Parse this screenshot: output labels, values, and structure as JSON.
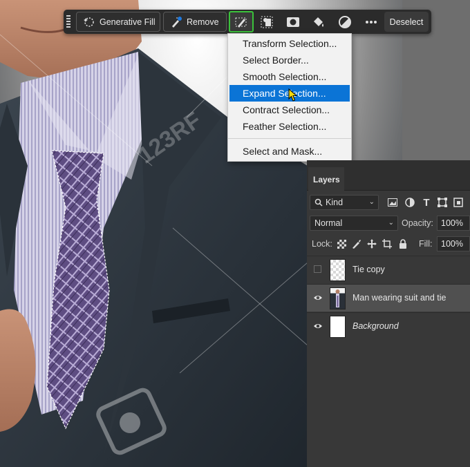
{
  "taskbar": {
    "generative_fill": "Generative Fill",
    "remove": "Remove",
    "deselect": "Deselect",
    "icons": [
      "selection-modify-icon",
      "subject-icon",
      "mask-icon",
      "fill-bucket-icon",
      "adjustment-icon",
      "more-icon"
    ]
  },
  "menu": {
    "items": [
      {
        "label": "Transform Selection..."
      },
      {
        "label": "Select Border..."
      },
      {
        "label": "Smooth Selection..."
      },
      {
        "label": "Expand Selection...",
        "highlighted": true
      },
      {
        "label": "Contract Selection..."
      },
      {
        "label": "Feather Selection..."
      },
      {
        "label": "Select and Mask..."
      }
    ]
  },
  "layers": {
    "tab": "Layers",
    "filter_kind": "Kind",
    "blend_mode": "Normal",
    "opacity_label": "Opacity:",
    "opacity_value": "100%",
    "lock_label": "Lock:",
    "fill_label": "Fill:",
    "fill_value": "100%",
    "list": [
      {
        "name": "Tie copy",
        "visible": false,
        "italic": false,
        "active": false
      },
      {
        "name": "Man wearing suit and tie",
        "visible": true,
        "italic": false,
        "active": true
      },
      {
        "name": "Background",
        "visible": true,
        "italic": true,
        "active": false
      }
    ]
  },
  "colors": {
    "accent_green": "#3bc33b",
    "menu_highlight": "#0b74d6",
    "panel": "#383838"
  }
}
